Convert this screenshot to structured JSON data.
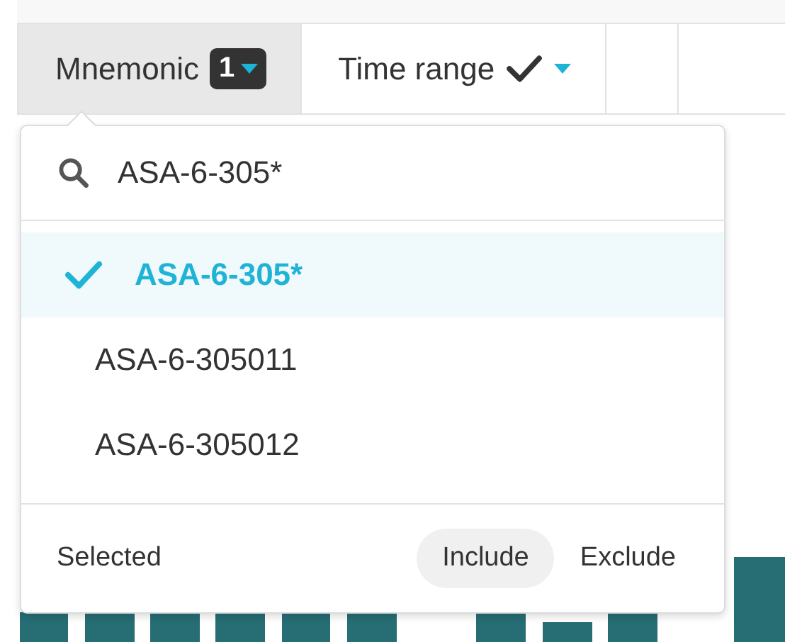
{
  "filters": [
    {
      "label": "Mnemonic",
      "selected": true,
      "badge": "1",
      "applied": false
    },
    {
      "label": "Time range",
      "selected": false,
      "applied": true
    }
  ],
  "dropdown": {
    "search": {
      "value": "ASA-6-305*"
    },
    "options": [
      {
        "label": "ASA-6-305*",
        "selected": true
      },
      {
        "label": "ASA-6-305011",
        "selected": false
      },
      {
        "label": "ASA-6-305012",
        "selected": false
      }
    ],
    "footer": {
      "label": "Selected",
      "modes": [
        {
          "label": "Include",
          "selected": true
        },
        {
          "label": "Exclude",
          "selected": false
        }
      ]
    }
  }
}
